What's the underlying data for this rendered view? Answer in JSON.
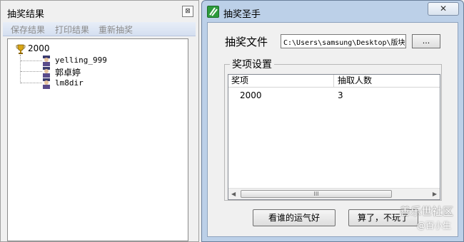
{
  "left_window": {
    "title": "抽奖结果",
    "close_glyph": "⊠",
    "toolbar": {
      "save": "保存结果",
      "print": "打印结果",
      "redraw": "重新抽奖"
    },
    "tree": {
      "root_label": "2000",
      "root_icon": "trophy-icon",
      "children": [
        {
          "label": "yelling_999",
          "icon": "user-icon"
        },
        {
          "label": "郭卓婷",
          "icon": "user-icon"
        },
        {
          "label": "lm8dir",
          "icon": "user-icon"
        }
      ]
    }
  },
  "right_window": {
    "title": "抽奖圣手",
    "close_glyph": "✕",
    "file_label": "抽奖文件",
    "file_path": "C:\\Users\\samsung\\Desktop\\版块",
    "browse_label": "...",
    "group_title": "奖项设置",
    "columns": [
      "奖项",
      "抽取人数"
    ],
    "rows": [
      {
        "prize": "2000",
        "count": "3"
      }
    ],
    "scroll_left": "◀",
    "scroll_right": "▶",
    "scroll_grip": "III",
    "buttons": {
      "lucky": "看谁的运气好",
      "cancel": "算了，不玩了"
    }
  },
  "watermark": {
    "site": "善乐世社区",
    "handle": "@百小生"
  },
  "colors": {
    "title_accent": "#2d9b3c",
    "window_frame": "#bcd0e8"
  }
}
